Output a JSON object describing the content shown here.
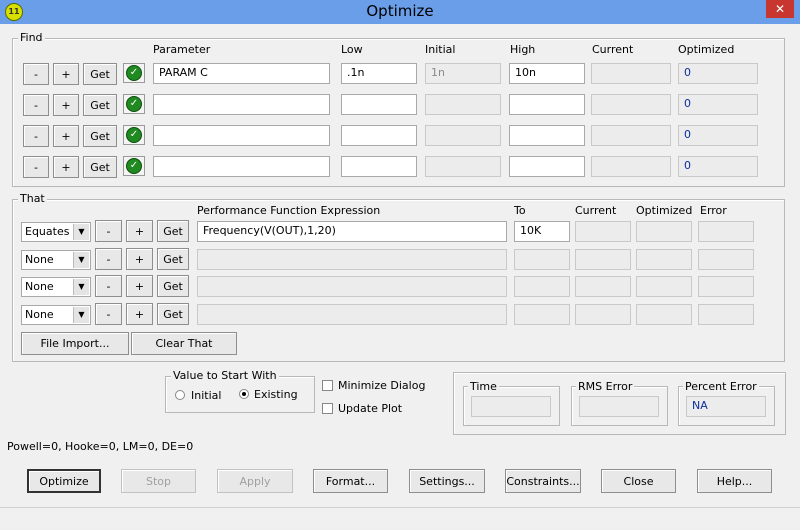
{
  "window": {
    "title": "Optimize",
    "icon": "app-logo-icon",
    "close": "✕"
  },
  "find": {
    "label": "Find",
    "headers": {
      "parameter": "Parameter",
      "low": "Low",
      "initial": "Initial",
      "high": "High",
      "current": "Current",
      "optimized": "Optimized"
    },
    "rows": [
      {
        "minus": "-",
        "plus": "+",
        "get": "Get",
        "parameter": "PARAM C",
        "low": ".1n",
        "initial": "1n",
        "high": "10n",
        "current": "",
        "optimized": "0"
      },
      {
        "minus": "-",
        "plus": "+",
        "get": "Get",
        "parameter": "",
        "low": "",
        "initial": "",
        "high": "",
        "current": "",
        "optimized": "0"
      },
      {
        "minus": "-",
        "plus": "+",
        "get": "Get",
        "parameter": "",
        "low": "",
        "initial": "",
        "high": "",
        "current": "",
        "optimized": "0"
      },
      {
        "minus": "-",
        "plus": "+",
        "get": "Get",
        "parameter": "",
        "low": "",
        "initial": "",
        "high": "",
        "current": "",
        "optimized": "0"
      }
    ]
  },
  "that": {
    "label": "That",
    "headers": {
      "expression": "Performance Function Expression",
      "to": "To",
      "current": "Current",
      "optimized": "Optimized",
      "error": "Error"
    },
    "rows": [
      {
        "type": "Equates",
        "minus": "-",
        "plus": "+",
        "get": "Get",
        "expression": "Frequency(V(OUT),1,20)",
        "to": "10K",
        "current": "",
        "optimized": "",
        "error": ""
      },
      {
        "type": "None",
        "minus": "-",
        "plus": "+",
        "get": "Get",
        "expression": "",
        "to": "",
        "current": "",
        "optimized": "",
        "error": ""
      },
      {
        "type": "None",
        "minus": "-",
        "plus": "+",
        "get": "Get",
        "expression": "",
        "to": "",
        "current": "",
        "optimized": "",
        "error": ""
      },
      {
        "type": "None",
        "minus": "-",
        "plus": "+",
        "get": "Get",
        "expression": "",
        "to": "",
        "current": "",
        "optimized": "",
        "error": ""
      }
    ],
    "file_import": "File Import...",
    "clear_that": "Clear That"
  },
  "start_with": {
    "label": "Value to Start With",
    "initial": "Initial",
    "existing": "Existing",
    "selected": "Existing"
  },
  "options": {
    "minimize_dialog": "Minimize Dialog",
    "update_plot": "Update Plot"
  },
  "results": {
    "time_label": "Time",
    "time": "",
    "rms_label": "RMS Error",
    "rms": "",
    "percent_label": "Percent Error",
    "percent": "NA"
  },
  "stats": "Powell=0, Hooke=0, LM=0, DE=0",
  "buttons": {
    "optimize": "Optimize",
    "stop": "Stop",
    "apply": "Apply",
    "format": "Format...",
    "settings": "Settings...",
    "constraints": "Constraints...",
    "close": "Close",
    "help": "Help..."
  }
}
